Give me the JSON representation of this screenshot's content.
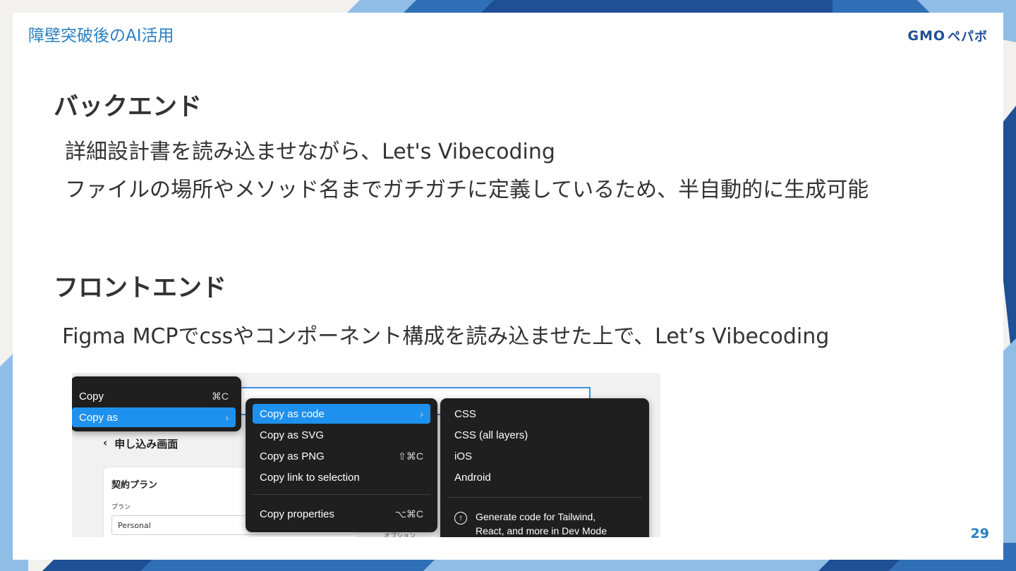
{
  "header": {
    "title": "障壁突破後のAI活用",
    "logo_gmo": "GMO",
    "logo_brand": "ペパボ"
  },
  "sections": [
    {
      "title": "バックエンド",
      "lines": [
        "詳細設計書を読み込ませながら、Let's Vibecoding",
        "ファイルの場所やメソッド名までガチガチに定義しているため、半自動的に生成可能"
      ]
    },
    {
      "title": "フロントエンド",
      "lines": [
        "Figma MCPでcssやコンポーネント構成を読み込ませた上で、Let’s Vibecoding"
      ]
    }
  ],
  "screenshot": {
    "background": {
      "back_label": "申し込み画面",
      "back_icon": "chevron-left-icon",
      "plan_heading": "契約プラン",
      "plan_label": "プラン",
      "plan_value": "Personal",
      "option_label": "オプション"
    },
    "menu_main": [
      {
        "label": "Copy",
        "shortcut": "⌘C"
      },
      {
        "label": "Copy as",
        "shortcut": "›",
        "selected": true
      }
    ],
    "menu_copy_as": [
      {
        "label": "Copy as code",
        "shortcut": "›",
        "selected": true
      },
      {
        "label": "Copy as SVG",
        "shortcut": ""
      },
      {
        "label": "Copy as PNG",
        "shortcut": "⇧⌘C"
      },
      {
        "label": "Copy link to selection",
        "shortcut": ""
      },
      {
        "label": "Copy properties",
        "shortcut": "⌥⌘C"
      }
    ],
    "menu_code": [
      {
        "label": "CSS"
      },
      {
        "label": "CSS (all layers)"
      },
      {
        "label": "iOS"
      },
      {
        "label": "Android"
      }
    ],
    "menu_code_footer": {
      "icon": "upgrade-arrow-icon",
      "line1": "Generate code for Tailwind,",
      "line2": "React, and more in Dev Mode"
    }
  },
  "page_number": "29",
  "colors": {
    "accent": "#2a7fc0",
    "menu_bg": "#1f1f1f",
    "menu_selected": "#1e91ee",
    "deco_dark": "#1f4f94",
    "deco_light": "#8fbde6"
  }
}
